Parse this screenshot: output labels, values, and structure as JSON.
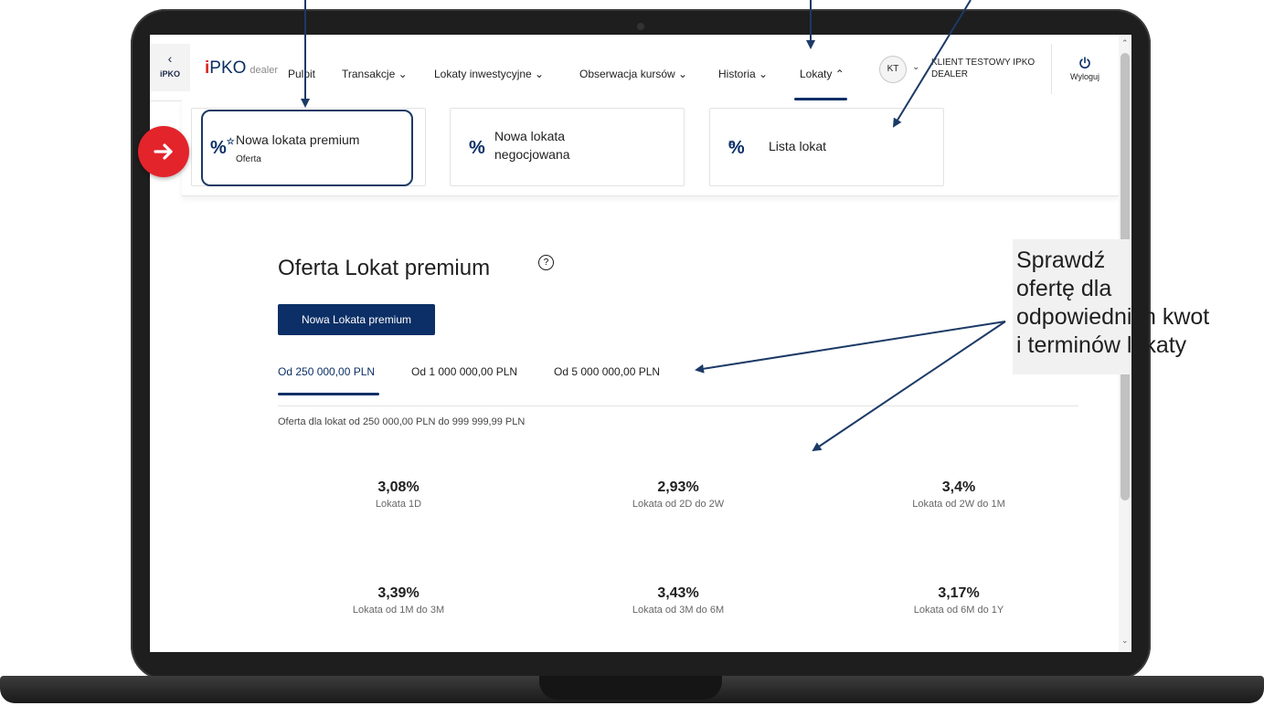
{
  "nav": {
    "back_label": "iPKO",
    "logo_brand": "PKO",
    "logo_sub": "dealer",
    "items": [
      {
        "label": "Pulpit"
      },
      {
        "label": "Transakcje ⌄"
      },
      {
        "label": "Lokaty inwestycyjne ⌄"
      },
      {
        "label": "Obserwacja kursów ⌄"
      },
      {
        "label": "Historia ⌄"
      },
      {
        "label": "Lokaty ⌃"
      }
    ],
    "avatar_initials": "KT",
    "client_name": "KLIENT TESTOWY IPKO DEALER",
    "logout_label": "Wyloguj"
  },
  "submenu": {
    "cards": [
      {
        "icon": "%",
        "title": "Nowa lokata premium",
        "subtitle": "Oferta"
      },
      {
        "icon": "%",
        "title": "Nowa lokata",
        "subtitle": "negocjowana"
      },
      {
        "icon": "%",
        "title": "Lista lokat",
        "subtitle": ""
      }
    ]
  },
  "main": {
    "title": "Oferta Lokat premium",
    "help": "?",
    "primary_button": "Nowa Lokata premium",
    "tabs": [
      {
        "label": "Od 250 000,00 PLN",
        "active": true
      },
      {
        "label": "Od 1 000 000,00 PLN",
        "active": false
      },
      {
        "label": "Od 5 000 000,00 PLN",
        "active": false
      }
    ],
    "offer_caption": "Oferta dla lokat od 250 000,00 PLN do 999 999,99 PLN",
    "rates": [
      {
        "value": "3,08%",
        "label": "Lokata 1D"
      },
      {
        "value": "2,93%",
        "label": "Lokata od 2D do 2W"
      },
      {
        "value": "3,4%",
        "label": "Lokata od 2W do 1M"
      },
      {
        "value": "3,39%",
        "label": "Lokata od 1M do 3M"
      },
      {
        "value": "3,43%",
        "label": "Lokata od 3M do 6M"
      },
      {
        "value": "3,17%",
        "label": "Lokata od 6M do 1Y"
      }
    ]
  },
  "annotation": {
    "callout": "Sprawdź\nofertę dla\nodpowiednich kwot\ni terminów lokaty"
  },
  "colors": {
    "brand_navy": "#0b2f66",
    "brand_red": "#d9271e",
    "annotation_red": "#e3242b",
    "annotation_arrow": "#1c3a66"
  }
}
